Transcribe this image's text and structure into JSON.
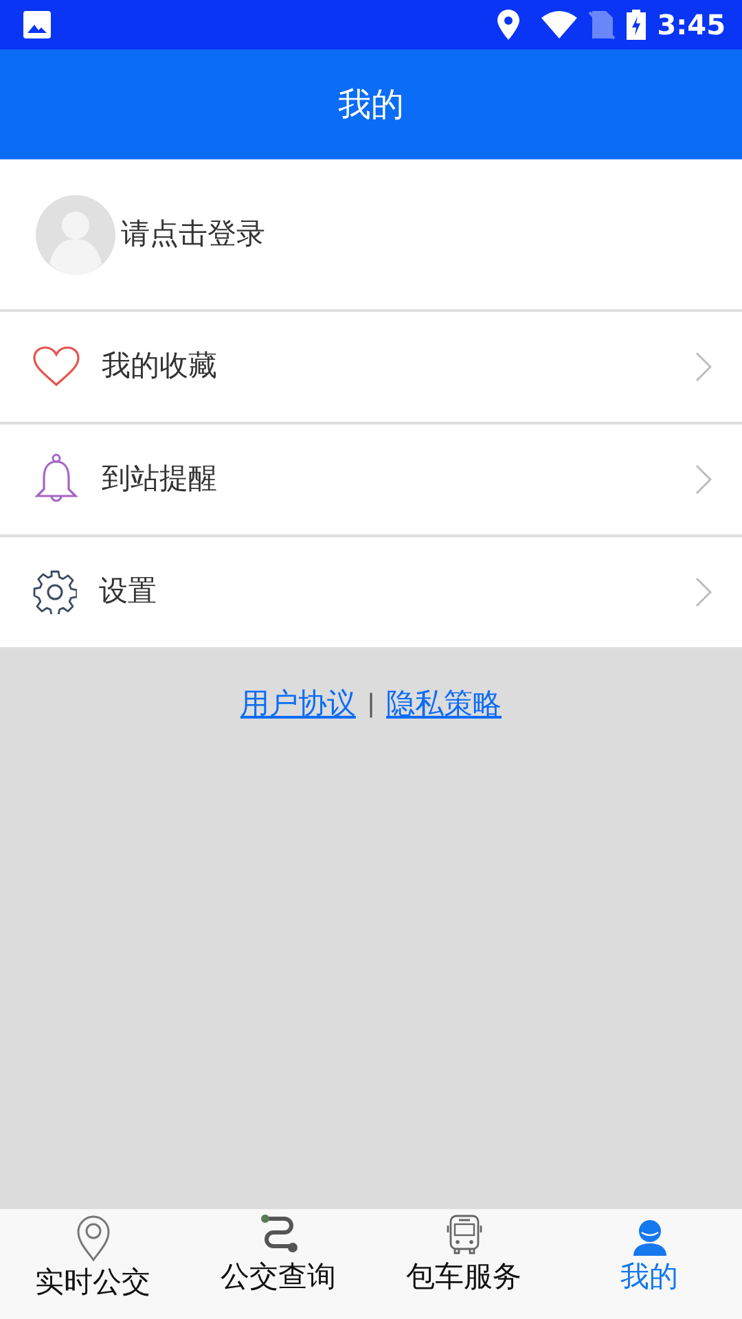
{
  "status_bar": {
    "time": "3:45"
  },
  "header": {
    "title": "我的"
  },
  "login": {
    "label": "请点击登录"
  },
  "menu": [
    {
      "kind": "heart",
      "label": "我的收藏"
    },
    {
      "kind": "bell",
      "label": "到站提醒"
    },
    {
      "kind": "gear",
      "label": "设置"
    }
  ],
  "links": [
    {
      "label": "用户协议"
    },
    {
      "label": "隐私策略"
    }
  ],
  "separator": "|",
  "tabs": [
    {
      "kind": "pin",
      "label": "实时公交",
      "selected": false
    },
    {
      "kind": "route",
      "label": "公交查询",
      "selected": false
    },
    {
      "kind": "bus",
      "label": "包车服务",
      "selected": false
    },
    {
      "kind": "person",
      "label": "我的",
      "selected": true
    }
  ]
}
